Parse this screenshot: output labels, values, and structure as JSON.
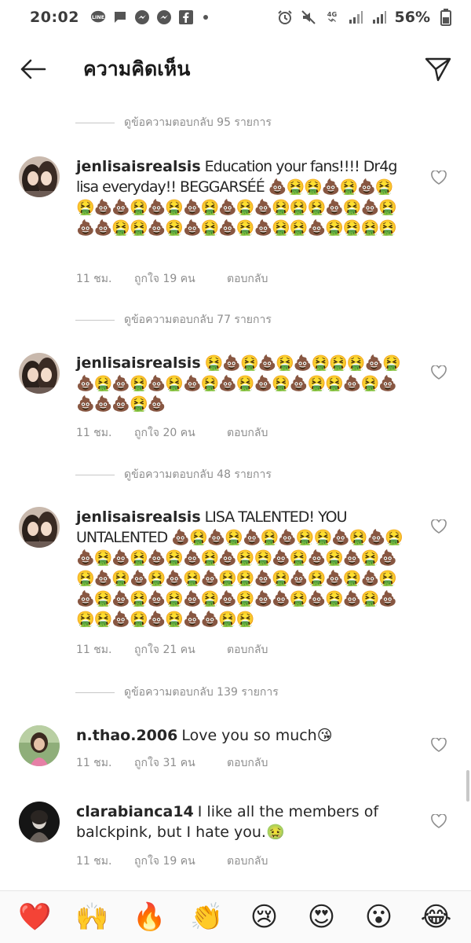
{
  "status_bar": {
    "time": "20:02",
    "battery": "56%",
    "network": "4G"
  },
  "header": {
    "title": "ความคิดเห็น"
  },
  "threads": [
    {
      "replies_label": "ดูข้อความตอบกลับ 95 รายการ",
      "username": "jenlisaisrealsis",
      "text": "Education your fans!!!! Dr4g lisa everyday!! BEGGARSÉÉ 💩🤮🤮💩🤮💩🤮🤮💩💩🤮💩🤮💩🤮💩🤮💩🤮🤮🤮💩🤮💩🤮💩💩🤮🤮💩🤮💩🤮💩🤮💩🤮🤮💩🤮🤮🤮🤮",
      "time": "11 ชม.",
      "likes": "ถูกใจ 19 คน",
      "reply": "ตอบกลับ",
      "avatar_type": "duo"
    },
    {
      "replies_label": "ดูข้อความตอบกลับ 77 รายการ",
      "username": "jenlisaisrealsis",
      "text": "🤮💩🤮💩🤮💩🤮🤮🤮💩🤮💩🤮💩🤮💩🤮💩🤮💩🤮💩🤮💩🤮🤮💩🤮💩💩💩💩🤮💩",
      "time": "11 ชม.",
      "likes": "ถูกใจ 20 คน",
      "reply": "ตอบกลับ",
      "avatar_type": "duo"
    },
    {
      "replies_label": "ดูข้อความตอบกลับ 48 รายการ",
      "username": "jenlisaisrealsis",
      "text": "LISA TALENTED!  YOU UNTALENTED 💩🤮💩🤮💩🤮💩🤮🤮💩🤮💩🤮💩🤮💩🤮💩🤮💩🤮💩🤮🤮💩🤮💩🤮💩🤮💩🤮💩🤮💩🤮💩🤮💩🤮🤮💩🤮💩🤮💩🤮💩🤮💩🤮💩🤮💩🤮💩🤮💩🤮💩💩🤮💩🤮💩🤮💩🤮🤮💩🤮💩🤮💩💩🤮🤮",
      "time": "11 ชม.",
      "likes": "ถูกใจ 21 คน",
      "reply": "ตอบกลับ",
      "avatar_type": "duo"
    },
    {
      "replies_label": "ดูข้อความตอบกลับ 139 รายการ",
      "username": "n.thao.2006",
      "text": "Love you so much😘",
      "time": "11 ชม.",
      "likes": "ถูกใจ 31 คน",
      "reply": "ตอบกลับ",
      "avatar_type": "girl"
    },
    {
      "replies_label": "",
      "username": "clarabianca14",
      "text": "I like all the members of balckpink, but I hate you.🤢",
      "time": "11 ชม.",
      "likes": "ถูกใจ 19 คน",
      "reply": "ตอบกลับ",
      "avatar_type": "dark"
    }
  ],
  "emoji_bar": [
    "❤️",
    "🙌",
    "🔥",
    "👏",
    "😢",
    "😍",
    "😮",
    "😂"
  ],
  "colors": {
    "text": "#262626",
    "secondary": "#8e8e8e",
    "like_outline": "#8e8e8e"
  }
}
